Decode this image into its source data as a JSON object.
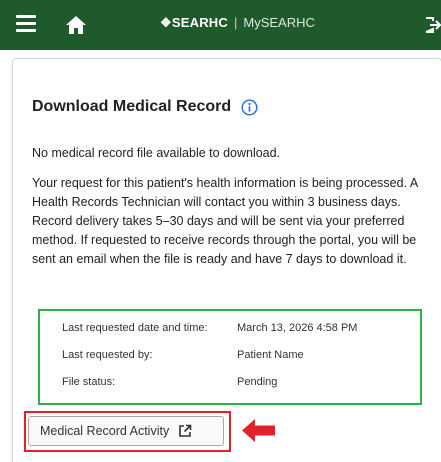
{
  "header": {
    "brand": "SEARHC",
    "separator": "|",
    "subtitle": "MySEARHC",
    "icons": [
      "menu-icon",
      "home-icon",
      "exit-icon"
    ],
    "bg_color": "#1e5a2c"
  },
  "main": {
    "title": "Download Medical Record",
    "no_file_text": "No medical record file available to download.",
    "request_text": "Your request for this patient's health information is being processed. A Health Records Technician will contact you within 3 business days. Record delivery takes 5–30 days and will be sent via your preferred method. If requested to receive records through the portal, you will be sent an email when the file is ready and have 7 days to download it.",
    "status": {
      "rows": [
        {
          "label": "Last requested date and time:",
          "value": "March 13, 2026 4:58 PM"
        },
        {
          "label": "Last requested by:",
          "value": "Patient Name"
        },
        {
          "label": "File status:",
          "value": "Pending"
        }
      ],
      "highlight_color": "#2db24a"
    },
    "activity_button": "Medical Record Activity",
    "callout_color": "#e0232b"
  }
}
